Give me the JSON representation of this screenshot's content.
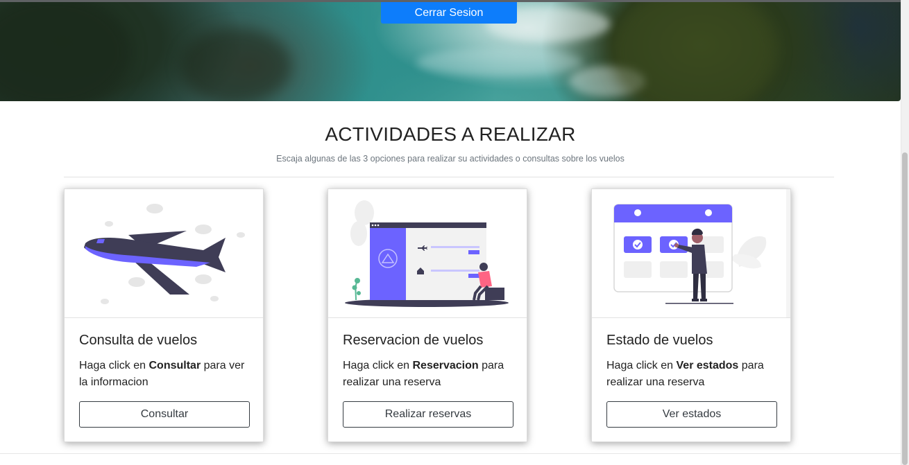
{
  "header": {
    "logout_label": "Cerrar Sesion"
  },
  "section": {
    "title": "ACTIVIDADES A REALIZAR",
    "subtitle": "Escaja algunas de las 3 opciones para realizar su actividades o consultas sobre los vuelos"
  },
  "cards": [
    {
      "illustration": "airplane-illustration",
      "title": "Consulta de vuelos",
      "text_prefix": "Haga click en ",
      "text_bold": "Consultar",
      "text_suffix": " para ver la informacion",
      "button_label": "Consultar"
    },
    {
      "illustration": "booking-illustration",
      "title": "Reservacion de vuelos",
      "text_prefix": "Haga click en ",
      "text_bold": "Reservacion",
      "text_suffix": " para realizar una reserva",
      "button_label": "Realizar reservas"
    },
    {
      "illustration": "calendar-illustration",
      "title": "Estado de vuelos",
      "text_prefix": "Haga click en ",
      "text_bold": "Ver estados",
      "text_suffix": " para realizar una reserva",
      "button_label": "Ver estados"
    }
  ],
  "colors": {
    "accent": "#0d7dfb",
    "illustration_primary": "#6c63ff",
    "illustration_dark": "#3f3d56"
  }
}
